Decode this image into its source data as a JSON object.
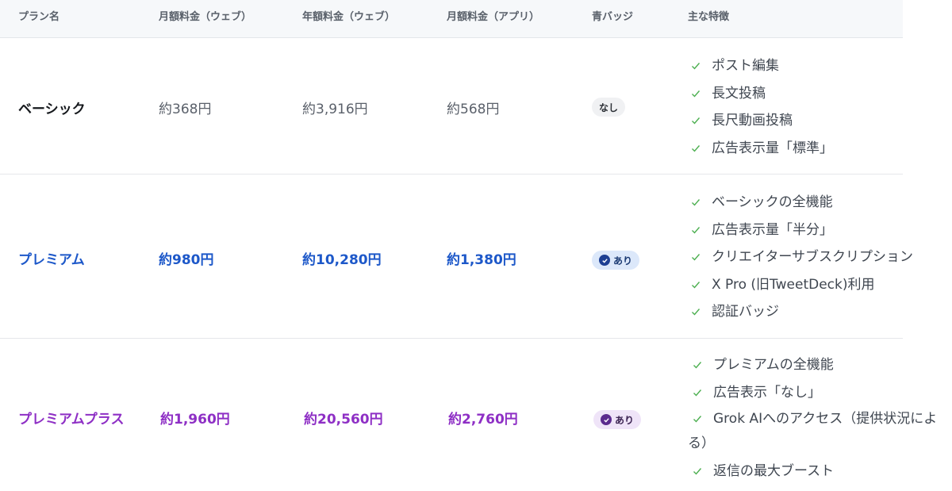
{
  "header": {
    "plan_name": "プラン名",
    "monthly_web": "月額料金（ウェブ）",
    "annual_web": "年額料金（ウェブ）",
    "monthly_app": "月額料金（アプリ）",
    "blue_badge": "青バッジ",
    "main_features": "主な特徴"
  },
  "colors": {
    "premium_blue": "#1d58c9",
    "premium_plus_purple": "#8e2fc5",
    "check_green": "#4caf50"
  },
  "plans": [
    {
      "name": "ベーシック",
      "monthly_web": "約368円",
      "annual_web": "約3,916円",
      "monthly_app": "約568円",
      "badge": "なし",
      "features": [
        "ポスト編集",
        "長文投稿",
        "長尺動画投稿",
        "広告表示量「標準」"
      ]
    },
    {
      "name": "プレミアム",
      "monthly_web": "約980円",
      "annual_web": "約10,280円",
      "monthly_app": "約1,380円",
      "badge": "あり",
      "badge_icon": "verified-check-icon",
      "features": [
        "ベーシックの全機能",
        "広告表示量「半分」",
        "クリエイターサブスクリプション",
        "X Pro (旧TweetDeck)利用",
        "認証バッジ"
      ]
    },
    {
      "name": "プレミアムプラス",
      "monthly_web": "約1,960円",
      "annual_web": "約20,560円",
      "monthly_app": "約2,760円",
      "badge": "あり",
      "badge_icon": "verified-check-icon",
      "features": [
        "プレミアムの全機能",
        "広告表示「なし」",
        "Grok AIへのアクセス（提供状況による）",
        "返信の最大ブースト"
      ]
    }
  ]
}
